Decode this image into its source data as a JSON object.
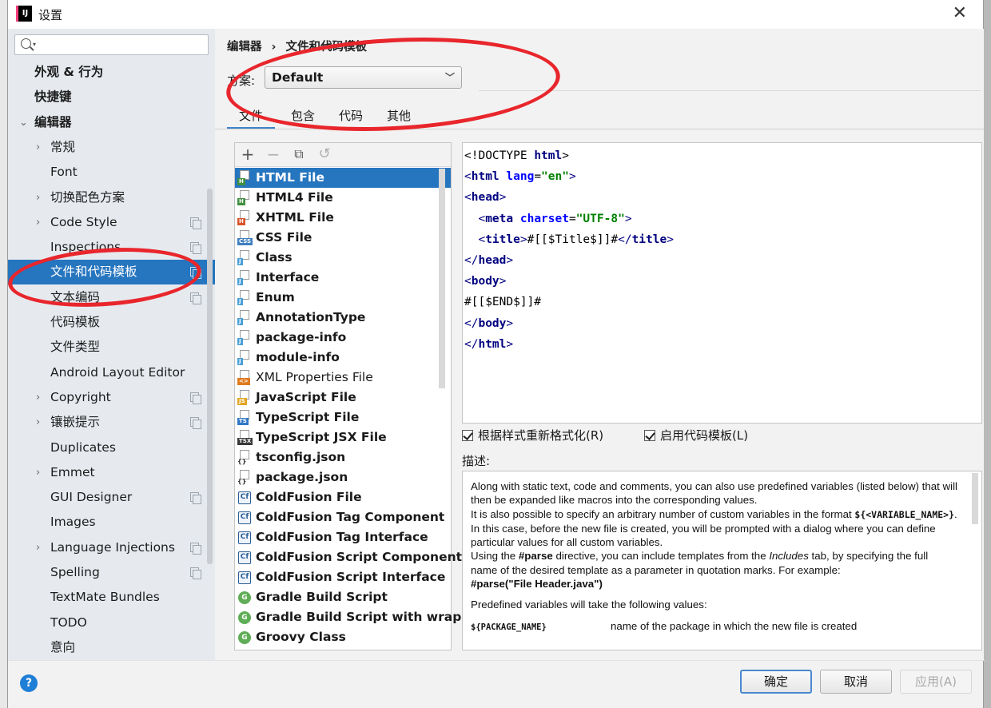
{
  "window": {
    "title": "设置",
    "app_icon": "IJ",
    "close_icon": "✕"
  },
  "sidebar": {
    "search_placeholder": "",
    "items": [
      {
        "label": "外观 & 行为",
        "bold": true,
        "arrow": ""
      },
      {
        "label": "快捷键",
        "bold": true,
        "arrow": ""
      },
      {
        "label": "编辑器",
        "bold": true,
        "arrow": "⌄"
      },
      {
        "label": "常规",
        "arrow": "›"
      },
      {
        "label": "Font",
        "arrow": ""
      },
      {
        "label": "切换配色方案",
        "arrow": "›"
      },
      {
        "label": "Code Style",
        "arrow": "›",
        "copy": true
      },
      {
        "label": "Inspections",
        "arrow": "",
        "copy": true
      },
      {
        "label": "文件和代码模板",
        "arrow": "",
        "copy": true,
        "selected": true
      },
      {
        "label": "文本编码",
        "arrow": "",
        "copy": true
      },
      {
        "label": "代码模板",
        "arrow": ""
      },
      {
        "label": "文件类型",
        "arrow": ""
      },
      {
        "label": "Android Layout Editor",
        "arrow": ""
      },
      {
        "label": "Copyright",
        "arrow": "›",
        "copy": true
      },
      {
        "label": "镶嵌提示",
        "arrow": "›",
        "copy": true
      },
      {
        "label": "Duplicates",
        "arrow": ""
      },
      {
        "label": "Emmet",
        "arrow": "›"
      },
      {
        "label": "GUI Designer",
        "arrow": "",
        "copy": true
      },
      {
        "label": "Images",
        "arrow": ""
      },
      {
        "label": "Language Injections",
        "arrow": "›",
        "copy": true
      },
      {
        "label": "Spelling",
        "arrow": "",
        "copy": true
      },
      {
        "label": "TextMate Bundles",
        "arrow": ""
      },
      {
        "label": "TODO",
        "arrow": ""
      },
      {
        "label": "意向",
        "arrow": ""
      }
    ]
  },
  "breadcrumb": {
    "part1": "编辑器",
    "sep": "›",
    "part2": "文件和代码模板"
  },
  "scheme": {
    "label": "方案:",
    "value": "Default"
  },
  "tabs": [
    {
      "label": "文件",
      "active": true
    },
    {
      "label": "包含"
    },
    {
      "label": "代码"
    },
    {
      "label": "其他"
    }
  ],
  "toolbar": {
    "add": "+",
    "remove": "−",
    "copy": "⧉",
    "reset": "↺"
  },
  "templates": [
    {
      "label": "HTML File",
      "icon": "html",
      "selected": true
    },
    {
      "label": "HTML4 File",
      "icon": "html"
    },
    {
      "label": "XHTML File",
      "icon": "xhtml"
    },
    {
      "label": "CSS File",
      "icon": "css"
    },
    {
      "label": "Class",
      "icon": "java"
    },
    {
      "label": "Interface",
      "icon": "java"
    },
    {
      "label": "Enum",
      "icon": "java"
    },
    {
      "label": "AnnotationType",
      "icon": "java"
    },
    {
      "label": "package-info",
      "icon": "java"
    },
    {
      "label": "module-info",
      "icon": "java"
    },
    {
      "label": "XML Properties File",
      "icon": "xml",
      "normal": true
    },
    {
      "label": "JavaScript File",
      "icon": "js"
    },
    {
      "label": "TypeScript File",
      "icon": "ts"
    },
    {
      "label": "TypeScript JSX File",
      "icon": "tsx"
    },
    {
      "label": "tsconfig.json",
      "icon": "json"
    },
    {
      "label": "package.json",
      "icon": "json"
    },
    {
      "label": "ColdFusion File",
      "icon": "cf"
    },
    {
      "label": "ColdFusion Tag Component",
      "icon": "cf"
    },
    {
      "label": "ColdFusion Tag Interface",
      "icon": "cf"
    },
    {
      "label": "ColdFusion Script Component",
      "icon": "cf"
    },
    {
      "label": "ColdFusion Script Interface",
      "icon": "cf"
    },
    {
      "label": "Gradle Build Script",
      "icon": "gradle"
    },
    {
      "label": "Gradle Build Script with wrapper",
      "icon": "gradle"
    },
    {
      "label": "Groovy Class",
      "icon": "gradle"
    }
  ],
  "icon_tags": {
    "html": "H",
    "xhtml": "H",
    "css": "CSS",
    "java": "J",
    "xml": "<>",
    "js": "JS",
    "ts": "TS",
    "tsx": "TSX",
    "json": "{}",
    "cf": "Cf",
    "gradle": "G"
  },
  "icon_colors": {
    "html": "#3f8f3f",
    "xhtml": "#d9542a",
    "css": "#3f7fbf",
    "java": "#4a9fd8",
    "xml": "#e07b20",
    "js": "#e2a521",
    "ts": "#3178c6",
    "tsx": "#3a3a3a",
    "gradle": "#5fad56"
  },
  "code": [
    [
      [
        "plain",
        "<!DOCTYPE "
      ],
      [
        "elem",
        "html"
      ],
      [
        "plain",
        ">"
      ]
    ],
    [
      [
        "tag",
        "<"
      ],
      [
        "elem",
        "html "
      ],
      [
        "attr",
        "lang"
      ],
      [
        "plain",
        "="
      ],
      [
        "val",
        "\"en\""
      ],
      [
        "tag",
        ">"
      ]
    ],
    [
      [
        "tag",
        "<"
      ],
      [
        "elem",
        "head"
      ],
      [
        "tag",
        ">"
      ]
    ],
    [
      [
        "plain",
        "  "
      ],
      [
        "tag",
        "<"
      ],
      [
        "elem",
        "meta "
      ],
      [
        "attr",
        "charset"
      ],
      [
        "plain",
        "="
      ],
      [
        "val",
        "\"UTF-8\""
      ],
      [
        "tag",
        ">"
      ]
    ],
    [
      [
        "plain",
        "  "
      ],
      [
        "tag",
        "<"
      ],
      [
        "elem",
        "title"
      ],
      [
        "tag",
        ">"
      ],
      [
        "plain",
        "#[[$Title$]]#"
      ],
      [
        "tag",
        "</"
      ],
      [
        "elem",
        "title"
      ],
      [
        "tag",
        ">"
      ]
    ],
    [
      [
        "tag",
        "</"
      ],
      [
        "elem",
        "head"
      ],
      [
        "tag",
        ">"
      ]
    ],
    [
      [
        "tag",
        "<"
      ],
      [
        "elem",
        "body"
      ],
      [
        "tag",
        ">"
      ]
    ],
    [
      [
        "plain",
        "#[[$END$]]#"
      ]
    ],
    [
      [
        "tag",
        "</"
      ],
      [
        "elem",
        "body"
      ],
      [
        "tag",
        ">"
      ]
    ],
    [
      [
        "tag",
        "</"
      ],
      [
        "elem",
        "html"
      ],
      [
        "tag",
        ">"
      ]
    ]
  ],
  "options": {
    "reformat": "根据样式重新格式化(R)",
    "enable_live": "启用代码模板(L)"
  },
  "description": {
    "label": "描述:",
    "p1a": "Along with static text, code and comments, you can also use predefined variables (listed below) that will then be expanded like macros into the corresponding values.",
    "p1b": "It is also possible to specify an arbitrary number of custom variables in the format",
    "var_format": "${<VARIABLE_NAME>}",
    "p1c": ". In this case, before the new file is created, you will be prompted with a dialog where you can define particular values for all custom variables.",
    "p1d": "Using the",
    "parse_kw": "#parse",
    "p1e": "directive, you can include templates from the",
    "includes": "Includes",
    "p1f": "tab, by specifying the full name of the desired template as a parameter in quotation marks. For example:",
    "example": "#parse(\"File Header.java\")",
    "p2": "Predefined variables will take the following values:",
    "var_name": "${PACKAGE_NAME}",
    "var_desc": "name of the package in which the new file is created"
  },
  "buttons": {
    "ok": "确定",
    "cancel": "取消",
    "apply": "应用(A)"
  },
  "help": "?",
  "colors": {
    "selection": "#2675bf",
    "annotation": "#e8262c"
  }
}
